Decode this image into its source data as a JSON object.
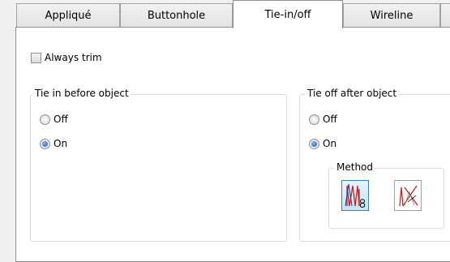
{
  "tabs": [
    {
      "label": "Appliqué",
      "active": false
    },
    {
      "label": "Buttonhole",
      "active": false
    },
    {
      "label": "Tie-in/off",
      "active": true
    },
    {
      "label": "Wireline",
      "active": false
    }
  ],
  "always_trim": {
    "label": "Always trim",
    "checked": false
  },
  "tie_in": {
    "title": "Tie in before object",
    "options": [
      {
        "label": "Off",
        "selected": false
      },
      {
        "label": "On",
        "selected": true
      }
    ]
  },
  "tie_off": {
    "title": "Tie off after object",
    "options": [
      {
        "label": "Off",
        "selected": false
      },
      {
        "label": "On",
        "selected": true
      }
    ],
    "method": {
      "title": "Method",
      "buttons": [
        {
          "icon": "zigzag-tie-icon",
          "selected": true
        },
        {
          "icon": "cross-tie-icon",
          "selected": false
        }
      ]
    }
  },
  "colors": {
    "stitch_red": "#d02020",
    "stitch_blue": "#1c3d8c",
    "selected_bg": "#c4e5f6"
  }
}
